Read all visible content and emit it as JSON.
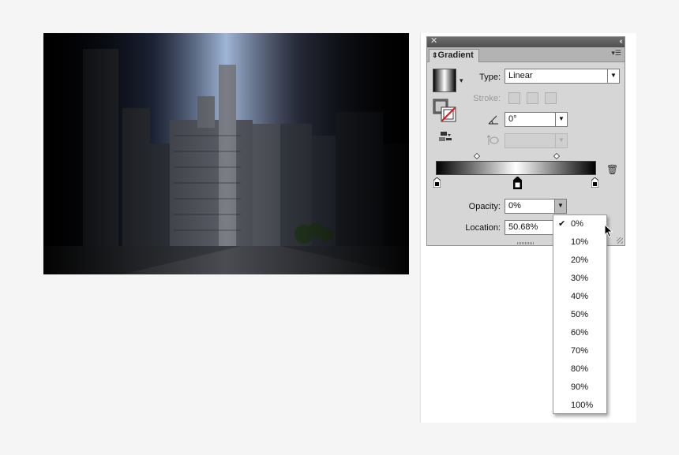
{
  "panel": {
    "tab_label": "Gradient",
    "close_glyph": "✕",
    "collapse_glyph": "‹‹",
    "menu_glyph": "▾☰",
    "type_label": "Type:",
    "type_value": "Linear",
    "stroke_label": "Stroke:",
    "angle_value": "0°",
    "opacity_label": "Opacity:",
    "opacity_value": "0%",
    "location_label": "Location:",
    "location_value": "50.68%"
  },
  "gradient": {
    "colors": [
      "#000000",
      "#ffffff",
      "#000000"
    ],
    "selected_stop_location": 50.68
  },
  "opacity_dropdown": {
    "selected": "0%",
    "options": [
      "0%",
      "10%",
      "20%",
      "30%",
      "40%",
      "50%",
      "60%",
      "70%",
      "80%",
      "90%",
      "100%"
    ]
  },
  "icons": {
    "close": "close-icon",
    "collapse": "collapse-icon",
    "panel_menu": "panel-menu-icon",
    "angle": "angle-icon",
    "aspect_ratio": "aspect-ratio-icon",
    "reverse": "reverse-gradient-icon",
    "trash": "trash-icon",
    "cursor": "mouse-cursor-icon"
  }
}
